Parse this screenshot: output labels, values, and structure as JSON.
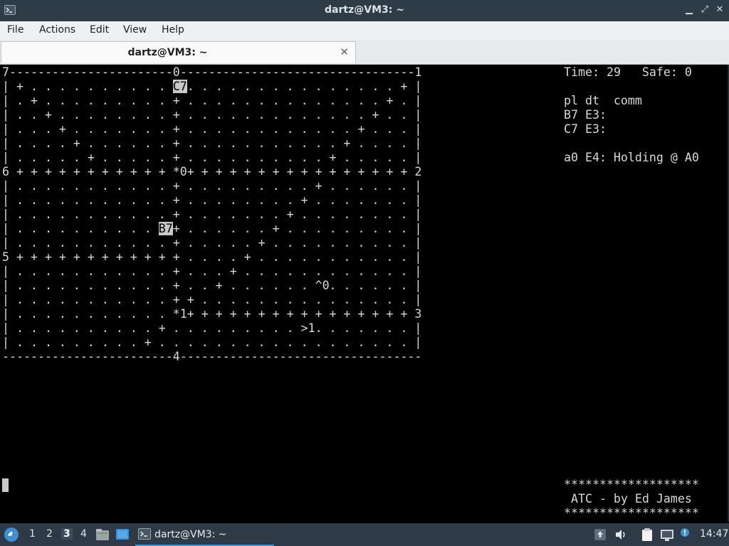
{
  "window": {
    "title": "dartz@VM3: ~",
    "minimize_symbol": "▁",
    "maximize_symbol": "⤢",
    "close_symbol": "✕"
  },
  "menu": {
    "file": "File",
    "actions": "Actions",
    "edit": "Edit",
    "view": "View",
    "help": "Help"
  },
  "tab": {
    "title": "dartz@VM3: ~",
    "close_symbol": "✕"
  },
  "game": {
    "board_lines": [
      "7-----------------------0---------------------------------1",
      "| + . . . . . . . . . . C7. . . . . . . . . . . . . . . + |",
      "| . + . . . . . . . . . + . . . . . . . . . . . . . . + . |",
      "| . . + . . . . . . . . + . . . . . . . . . . . . . + . . |",
      "| . . . + . . . . . . . + . . . . . . . . . . . . + . . . |",
      "| . . . . + . . . . . . + . . . . . . . . . . . + . . . . |",
      "| . . . . . + . . . . . + . . . . . . . . . . + . . . . . |",
      "6 + + + + + + + + + + + *0+ + + + + + + + + + + + + + + + 2",
      "| . . . . . . . . . . . + . . . . . . . . . + . . . . . . |",
      "| . . . . . . . . . . . + . . . . . . . . + . . . . . . . |",
      "| . . . . . . . . . . . + . . . . . . . + . . . . . . . . |",
      "| . . . . . . . . . . B7+ . . . . . . + . . . . . . . . . |",
      "| . . . . . . . . . . . + . . . . . + . . . . . . . . . . |",
      "5 + + + + + + + + + + + + . . . . + . . . . . . . . . . . |",
      "| . . . . . . . . . . . + . . . + . . . . . . . . . . . . |",
      "| . . . . . . . . . . . + . . + . . . . . . ^0. . . . . . |",
      "| . . . . . . . . . . . + + . . . . . . . . . . . . . . . |",
      "| . . . . . . . . . . . *1+ + + + + + + + + + + + + + + + 3",
      "| . . . . . . . . . . + . . . . . . . . . >1. . . . . . . |",
      "| . . . . . . . . . + . . . . . . . . . . . . . . . . . . |",
      "------------------------4----------------------------------"
    ],
    "status": {
      "time_label": "Time:",
      "time_value": "29",
      "safe_label": "Safe:",
      "safe_value": "0",
      "header": "pl dt  comm",
      "planes": [
        "B7 E3:",
        "C7 E3:"
      ],
      "a0": "a0 E4: Holding @ A0"
    },
    "credits": {
      "stars": "*******************",
      "text": " ATC - by Ed James"
    }
  },
  "taskbar": {
    "workspaces": [
      "1",
      "2",
      "3",
      "4"
    ],
    "active_workspace": "3",
    "task_label": "dartz@VM3: ~",
    "clock": "14:47"
  },
  "colors": {
    "titlebar": "#2e3c48",
    "menubar": "#eff0f1",
    "terminal_bg": "#000000",
    "terminal_fg": "#d8d8d8",
    "highlight_bg": "#c8c8c8",
    "taskbar": "#2e3b47",
    "task_underline": "#3a8fd9"
  }
}
